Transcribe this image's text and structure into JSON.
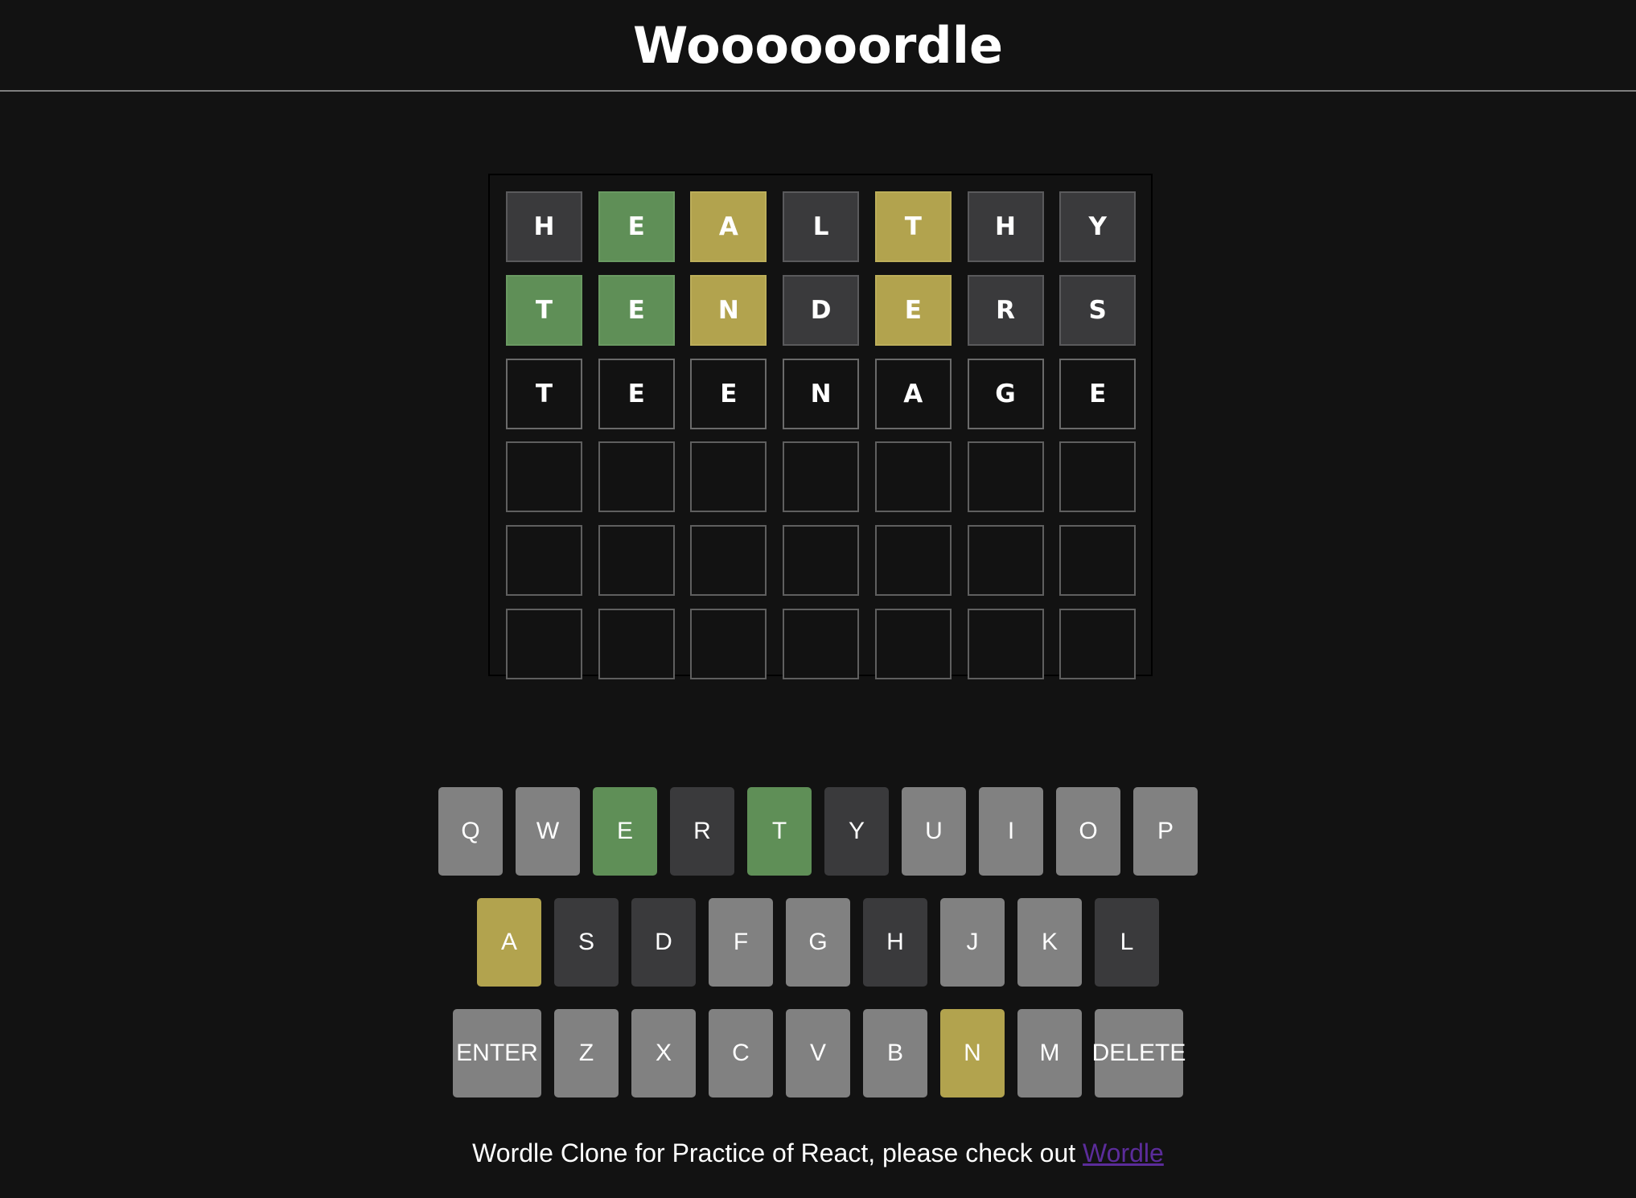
{
  "header": {
    "title": "Woooooordle"
  },
  "board": {
    "rows": [
      [
        {
          "letter": "H",
          "state": "error"
        },
        {
          "letter": "E",
          "state": "correct"
        },
        {
          "letter": "A",
          "state": "almost"
        },
        {
          "letter": "L",
          "state": "error"
        },
        {
          "letter": "T",
          "state": "almost"
        },
        {
          "letter": "H",
          "state": "error"
        },
        {
          "letter": "Y",
          "state": "error"
        }
      ],
      [
        {
          "letter": "T",
          "state": "correct"
        },
        {
          "letter": "E",
          "state": "correct"
        },
        {
          "letter": "N",
          "state": "almost"
        },
        {
          "letter": "D",
          "state": "error"
        },
        {
          "letter": "E",
          "state": "almost"
        },
        {
          "letter": "R",
          "state": "error"
        },
        {
          "letter": "S",
          "state": "error"
        }
      ],
      [
        {
          "letter": "T",
          "state": "typed"
        },
        {
          "letter": "E",
          "state": "typed"
        },
        {
          "letter": "E",
          "state": "typed"
        },
        {
          "letter": "N",
          "state": "typed"
        },
        {
          "letter": "A",
          "state": "typed"
        },
        {
          "letter": "G",
          "state": "typed"
        },
        {
          "letter": "E",
          "state": "typed"
        }
      ],
      [
        {
          "letter": "",
          "state": "empty"
        },
        {
          "letter": "",
          "state": "empty"
        },
        {
          "letter": "",
          "state": "empty"
        },
        {
          "letter": "",
          "state": "empty"
        },
        {
          "letter": "",
          "state": "empty"
        },
        {
          "letter": "",
          "state": "empty"
        },
        {
          "letter": "",
          "state": "empty"
        }
      ],
      [
        {
          "letter": "",
          "state": "empty"
        },
        {
          "letter": "",
          "state": "empty"
        },
        {
          "letter": "",
          "state": "empty"
        },
        {
          "letter": "",
          "state": "empty"
        },
        {
          "letter": "",
          "state": "empty"
        },
        {
          "letter": "",
          "state": "empty"
        },
        {
          "letter": "",
          "state": "empty"
        }
      ],
      [
        {
          "letter": "",
          "state": "empty"
        },
        {
          "letter": "",
          "state": "empty"
        },
        {
          "letter": "",
          "state": "empty"
        },
        {
          "letter": "",
          "state": "empty"
        },
        {
          "letter": "",
          "state": "empty"
        },
        {
          "letter": "",
          "state": "empty"
        },
        {
          "letter": "",
          "state": "empty"
        }
      ]
    ]
  },
  "keyboard": {
    "rows": [
      [
        {
          "label": "Q",
          "state": "default"
        },
        {
          "label": "W",
          "state": "default"
        },
        {
          "label": "E",
          "state": "correct"
        },
        {
          "label": "R",
          "state": "error"
        },
        {
          "label": "T",
          "state": "correct"
        },
        {
          "label": "Y",
          "state": "error"
        },
        {
          "label": "U",
          "state": "default"
        },
        {
          "label": "I",
          "state": "default"
        },
        {
          "label": "O",
          "state": "default"
        },
        {
          "label": "P",
          "state": "default"
        }
      ],
      [
        {
          "label": "A",
          "state": "almost"
        },
        {
          "label": "S",
          "state": "error"
        },
        {
          "label": "D",
          "state": "error"
        },
        {
          "label": "F",
          "state": "default"
        },
        {
          "label": "G",
          "state": "default"
        },
        {
          "label": "H",
          "state": "error"
        },
        {
          "label": "J",
          "state": "default"
        },
        {
          "label": "K",
          "state": "default"
        },
        {
          "label": "L",
          "state": "error"
        }
      ],
      [
        {
          "label": "ENTER",
          "state": "default"
        },
        {
          "label": "Z",
          "state": "default"
        },
        {
          "label": "X",
          "state": "default"
        },
        {
          "label": "C",
          "state": "default"
        },
        {
          "label": "V",
          "state": "default"
        },
        {
          "label": "B",
          "state": "default"
        },
        {
          "label": "N",
          "state": "almost"
        },
        {
          "label": "M",
          "state": "default"
        },
        {
          "label": "DELETE",
          "state": "default"
        }
      ]
    ]
  },
  "footer": {
    "text": "Wordle Clone for Practice of React, please check out ",
    "link_label": "Wordle"
  },
  "colors": {
    "background": "#121212",
    "correct": "#5f8f57",
    "almost": "#b2a34e",
    "error": "#3a3a3c",
    "key_default": "#818181",
    "link": "#5b2c9a"
  }
}
